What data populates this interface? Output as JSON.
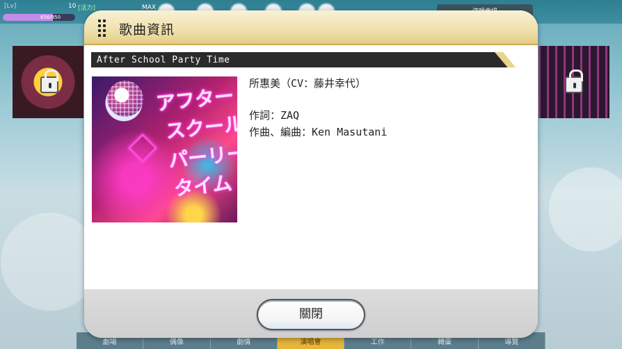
{
  "hud": {
    "level_label": "[Lv]",
    "level_value": "10",
    "stamina_label": "[活力]",
    "stamina_value": "656/950",
    "max_label": "MAX",
    "exp_fraction": 0.69,
    "right_pill": "演唱會場"
  },
  "bottom_nav": {
    "tabs": [
      "劇場",
      "偶像",
      "劇情",
      "演唱會",
      "工作",
      "轉蛋",
      "導覽"
    ],
    "active_index": 3
  },
  "dialog": {
    "title": "歌曲資訊",
    "song_name": "After School Party Time",
    "jacket_art_text": [
      "アフター",
      "スクール",
      "パーリー",
      "タイム"
    ],
    "singer": "所惠美（CV：藤井幸代）",
    "lyrics": "作詞：ZAQ",
    "composition": "作曲、編曲：Ken Masutani",
    "close_label": "關閉"
  }
}
